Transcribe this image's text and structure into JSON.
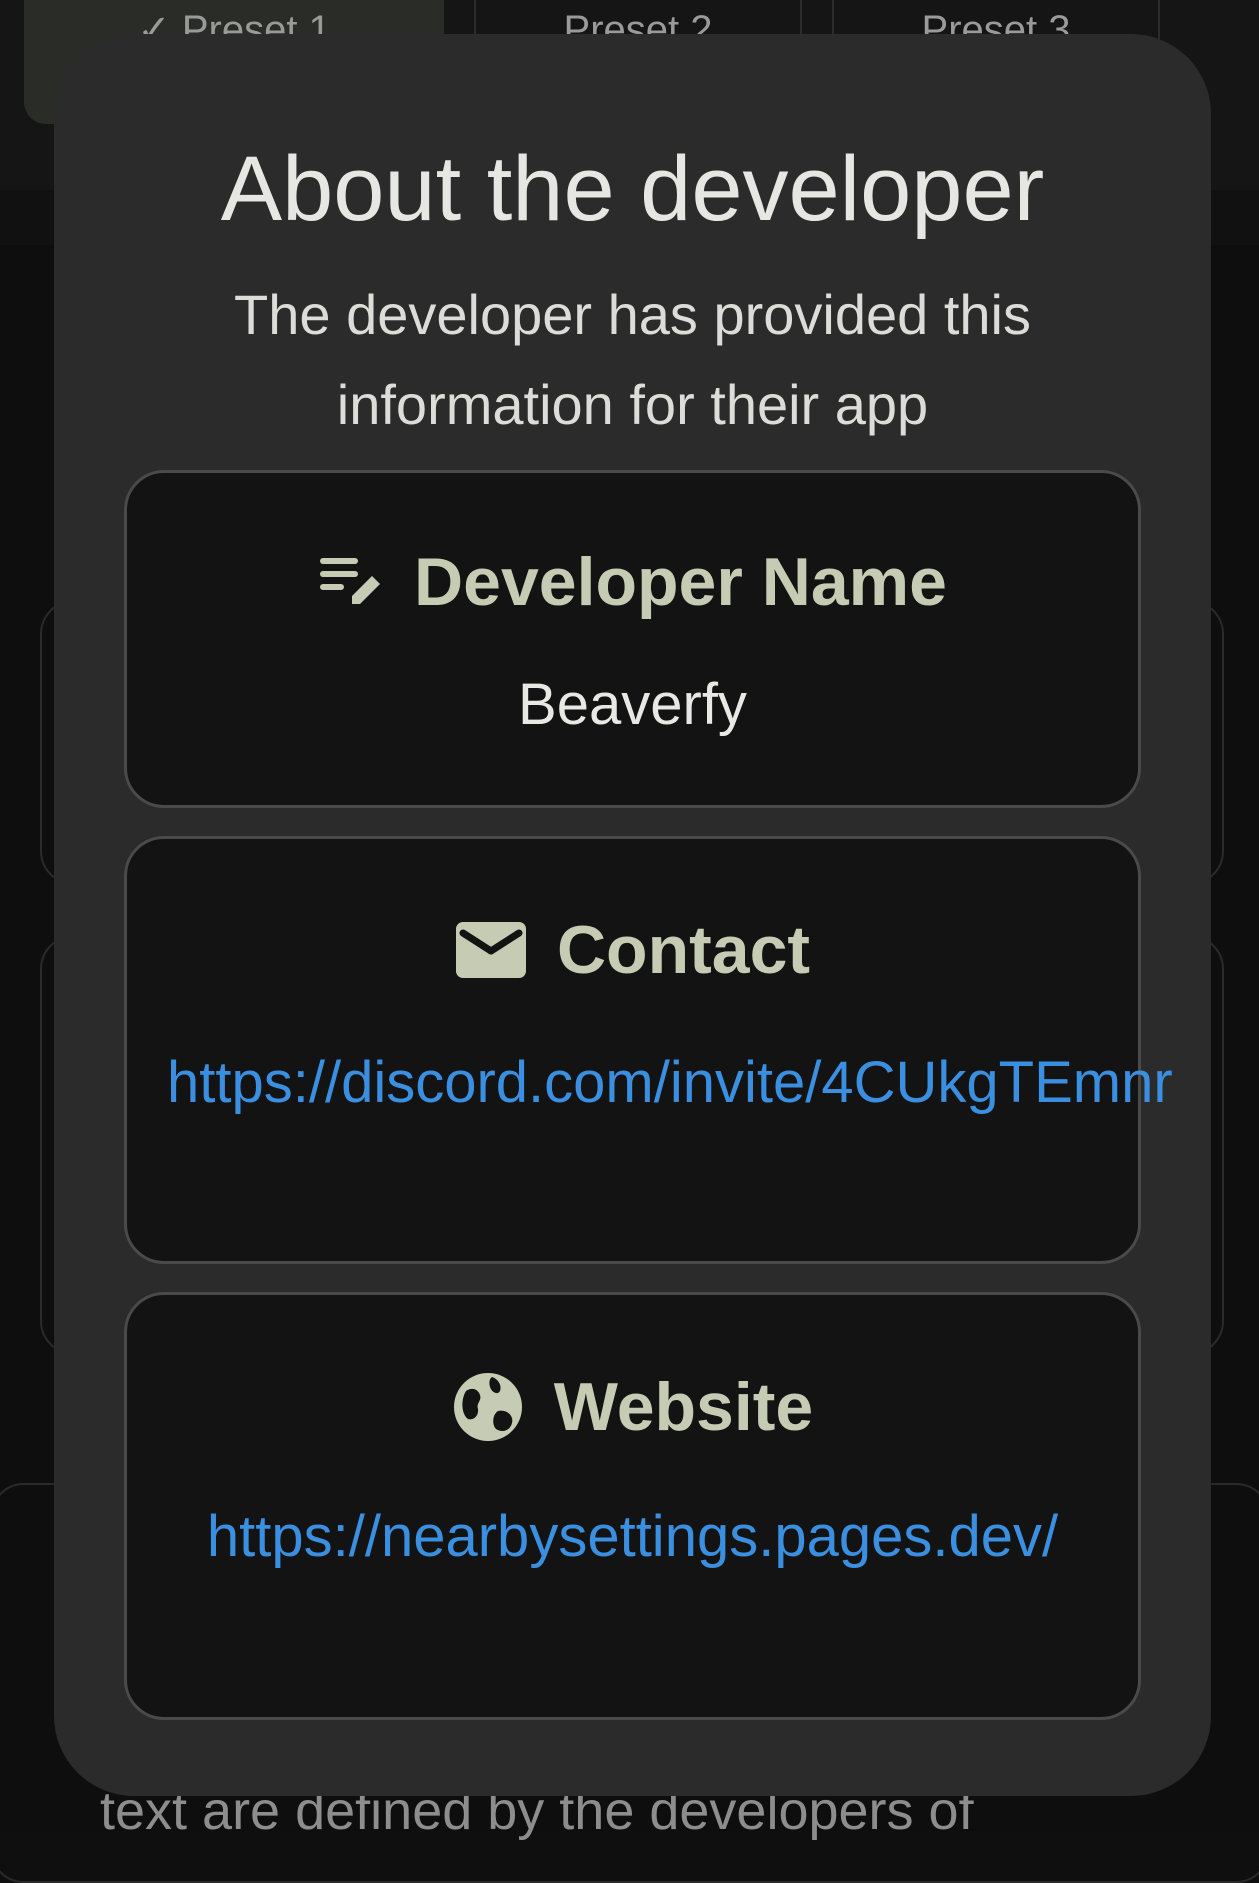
{
  "background": {
    "chips": [
      {
        "label": "✓ Preset 1"
      },
      {
        "label": "Preset 2"
      },
      {
        "label": "Preset 3"
      }
    ],
    "bottom_text": "text are defined by the developers of"
  },
  "dialog": {
    "title": "About the developer",
    "subtitle": "The developer has provided this information for their app",
    "cards": {
      "developer": {
        "icon": "edit-note-icon",
        "label": "Developer Name",
        "value": "Beaverfy"
      },
      "contact": {
        "icon": "mail-icon",
        "label": "Contact",
        "value": "https://discord.com/invite/4CUkgTEmnr"
      },
      "website": {
        "icon": "globe-icon",
        "label": "Website",
        "value": "https://nearbysettings.pages.dev/"
      }
    }
  },
  "colors": {
    "dialog_bg": "#2b2b2b",
    "card_bg": "#131313",
    "accent": "#c5ccb3",
    "link": "#3a8fe0"
  }
}
